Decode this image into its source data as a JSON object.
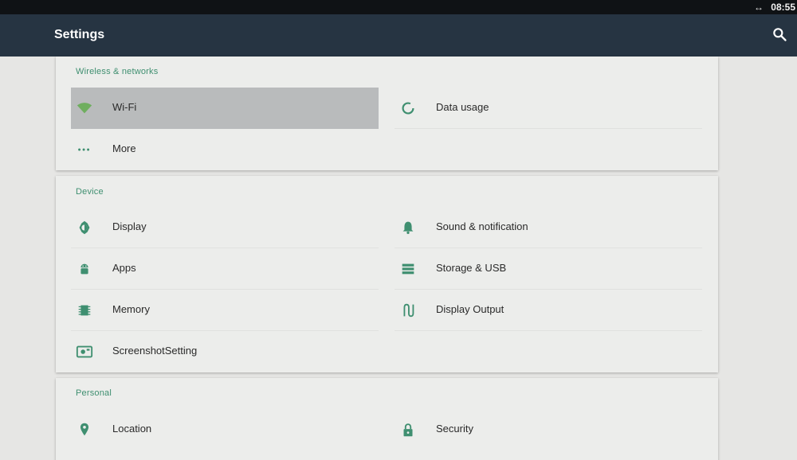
{
  "status_bar": {
    "time": "08:55",
    "icon": "swap-horizontal-icon"
  },
  "app_bar": {
    "title": "Settings",
    "search_icon": "search-icon"
  },
  "accent_color": "#3f8f70",
  "sections": [
    {
      "header": "Wireless & networks",
      "items": [
        {
          "label": "Wi-Fi",
          "icon": "wifi-icon",
          "selected": true
        },
        {
          "label": "Data usage",
          "icon": "data-usage-icon"
        },
        {
          "label": "More",
          "icon": "more-dots-icon"
        }
      ]
    },
    {
      "header": "Device",
      "items": [
        {
          "label": "Display",
          "icon": "brightness-icon"
        },
        {
          "label": "Sound & notification",
          "icon": "bell-icon"
        },
        {
          "label": "Apps",
          "icon": "android-icon"
        },
        {
          "label": "Storage & USB",
          "icon": "storage-icon"
        },
        {
          "label": "Memory",
          "icon": "memory-chip-icon"
        },
        {
          "label": "Display Output",
          "icon": "cable-icon"
        },
        {
          "label": "ScreenshotSetting",
          "icon": "screenshot-icon"
        }
      ]
    },
    {
      "header": "Personal",
      "items": [
        {
          "label": "Location",
          "icon": "location-pin-icon"
        },
        {
          "label": "Security",
          "icon": "lock-icon"
        }
      ]
    }
  ]
}
